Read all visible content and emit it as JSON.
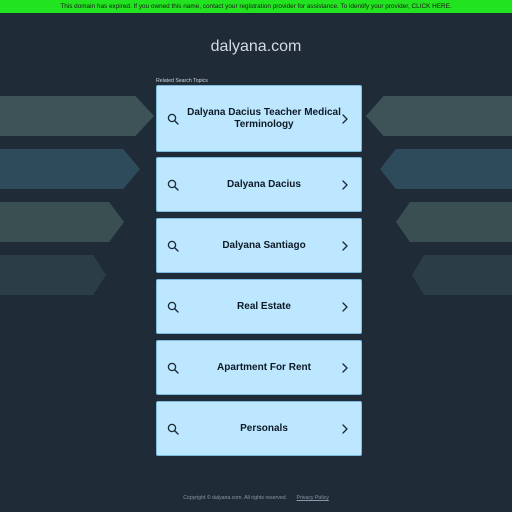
{
  "banner": {
    "text": "This domain has expired. If you owned this name, contact your registration provider for assistance. To identify your provider, CLICK HERE."
  },
  "domain": {
    "title": "dalyana.com"
  },
  "related": {
    "label": "Related Search Topics",
    "items": [
      {
        "label": "Dalyana Dacius Teacher Medical Terminology"
      },
      {
        "label": "Dalyana Dacius"
      },
      {
        "label": "Dalyana Santiago"
      },
      {
        "label": "Real Estate"
      },
      {
        "label": "Apartment For Rent"
      },
      {
        "label": "Personals"
      }
    ]
  },
  "footer": {
    "copyright": "Copyright © dalyana.com.  All rights reserved.",
    "privacy_label": "Privacy Policy"
  },
  "colors": {
    "background": "#1f2b36",
    "banner": "#22e31f",
    "card": "#bde6ff",
    "card_border": "#7dbbe0"
  },
  "icons": {
    "card_left": "search-icon",
    "card_right": "chevron-right-icon"
  }
}
